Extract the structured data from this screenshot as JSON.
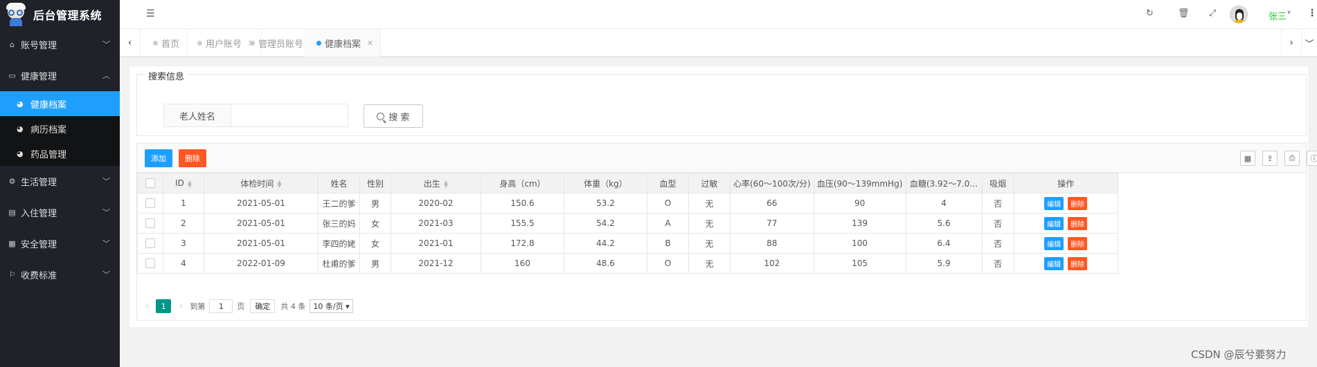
{
  "app": {
    "title": "后台管理系统"
  },
  "sidebar": {
    "items": [
      {
        "label": "账号管理",
        "icon": "home-icon"
      },
      {
        "label": "健康管理",
        "icon": "window-icon",
        "children": [
          {
            "label": "健康档案",
            "active": true
          },
          {
            "label": "病历档案"
          },
          {
            "label": "药品管理"
          }
        ]
      },
      {
        "label": "生活管理",
        "icon": "gears-icon"
      },
      {
        "label": "入住管理",
        "icon": "file-icon"
      },
      {
        "label": "安全管理",
        "icon": "calendar-icon"
      },
      {
        "label": "收费标准",
        "icon": "flag-icon"
      }
    ]
  },
  "header": {
    "username": "张三"
  },
  "tabs": [
    {
      "label": "首页",
      "closable": false
    },
    {
      "label": "用户账号",
      "closable": true
    },
    {
      "label": "管理员账号",
      "closable": true
    },
    {
      "label": "健康档案",
      "closable": true,
      "active": true
    }
  ],
  "search": {
    "legend": "搜索信息",
    "label": "老人姓名",
    "value": "",
    "button": "搜 索"
  },
  "toolbar": {
    "add": "添加",
    "delete": "删除"
  },
  "table": {
    "columns": [
      "ID",
      "体检时间",
      "姓名",
      "性别",
      "出生",
      "身高（cm）",
      "体重（kg）",
      "血型",
      "过敏",
      "心率(60～100次/分)",
      "血压(90～139mmHg)",
      "血糖(3.92～7.0…",
      "吸烟",
      "操作"
    ],
    "rows": [
      [
        "1",
        "2021-05-01",
        "王二的爹",
        "男",
        "2020-02",
        "150.6",
        "53.2",
        "O",
        "无",
        "66",
        "90",
        "4",
        "否"
      ],
      [
        "2",
        "2021-05-01",
        "张三的妈",
        "女",
        "2021-03",
        "155.5",
        "54.2",
        "A",
        "无",
        "77",
        "139",
        "5.6",
        "否"
      ],
      [
        "3",
        "2021-05-01",
        "李四的姥",
        "女",
        "2021-01",
        "172.8",
        "44.2",
        "B",
        "无",
        "88",
        "100",
        "6.4",
        "否"
      ],
      [
        "4",
        "2022-01-09",
        "杜甫的爹",
        "男",
        "2021-12",
        "160",
        "48.6",
        "O",
        "无",
        "102",
        "105",
        "5.9",
        "否"
      ]
    ],
    "edit_label": "编辑",
    "delete_label": "删除"
  },
  "pager": {
    "current": "1",
    "goto_prefix": "到第",
    "goto_value": "1",
    "goto_suffix": "页",
    "confirm": "确定",
    "total": "共 4 条",
    "page_size": "10 条/页"
  },
  "watermark": "CSDN @辰兮要努力",
  "colors": {
    "primary": "#1e9fff",
    "danger": "#ff5722",
    "pager": "#009688",
    "sidebar": "#20222a"
  }
}
